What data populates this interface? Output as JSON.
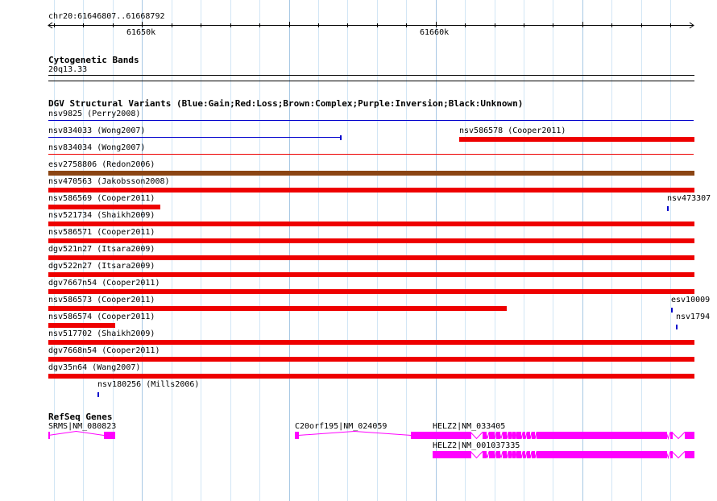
{
  "ruler": {
    "range_label": "chr20:61646807..61668792",
    "ticks": [
      {
        "label": "61650k",
        "pos": 61650000
      },
      {
        "label": "61660k",
        "pos": 61660000
      }
    ],
    "start": 61646807,
    "end": 61668792
  },
  "cytoband": {
    "title": "Cytogenetic Bands",
    "band": "20q13.33"
  },
  "dgv": {
    "title": "DGV Structural Variants (Blue:Gain;Red:Loss;Brown:Complex;Purple:Inversion;Black:Unknown)",
    "colors": {
      "gain": "#0000cc",
      "loss": "#ee0000",
      "complex": "#8b4513",
      "inversion": "#800080",
      "unknown": "#000000"
    },
    "rows": [
      {
        "features": [
          {
            "label": "nsv9825 (Perry2008)",
            "type": "gain",
            "style": "line",
            "start": 61646807,
            "end": 61668792
          }
        ]
      },
      {
        "features": [
          {
            "label": "nsv834033 (Wong2007)",
            "type": "gain",
            "style": "line",
            "start": 61646807,
            "end": 61656750
          },
          {
            "label": "nsv586578 (Cooper2011)",
            "type": "loss",
            "style": "bar",
            "start": 61660800,
            "end": 61668792
          }
        ]
      },
      {
        "features": [
          {
            "label": "nsv834034 (Wong2007)",
            "type": "loss",
            "style": "line",
            "start": 61646807,
            "end": 61668792
          }
        ]
      },
      {
        "features": [
          {
            "label": "esv2758806 (Redon2006)",
            "type": "complex",
            "style": "bar",
            "start": 61646807,
            "end": 61668792
          }
        ]
      },
      {
        "features": [
          {
            "label": "nsv470563 (Jakobsson2008)",
            "type": "loss",
            "style": "bar",
            "start": 61646807,
            "end": 61668792
          }
        ]
      },
      {
        "features": [
          {
            "label": "nsv586569 (Cooper2011)",
            "type": "loss",
            "style": "bar",
            "start": 61646807,
            "end": 61650600
          },
          {
            "label": "nsv473307",
            "type": "gain",
            "style": "tick",
            "start": 61667880,
            "end": 61667950
          }
        ]
      },
      {
        "features": [
          {
            "label": "nsv521734 (Shaikh2009)",
            "type": "loss",
            "style": "bar",
            "start": 61646807,
            "end": 61668792
          }
        ]
      },
      {
        "features": [
          {
            "label": "nsv586571 (Cooper2011)",
            "type": "loss",
            "style": "bar",
            "start": 61646807,
            "end": 61668792
          }
        ]
      },
      {
        "features": [
          {
            "label": "dgv521n27 (Itsara2009)",
            "type": "loss",
            "style": "bar",
            "start": 61646807,
            "end": 61668792
          }
        ]
      },
      {
        "features": [
          {
            "label": "dgv522n27 (Itsara2009)",
            "type": "loss",
            "style": "bar",
            "start": 61646807,
            "end": 61668792
          }
        ]
      },
      {
        "features": [
          {
            "label": "dgv7667n54 (Cooper2011)",
            "type": "loss",
            "style": "bar",
            "start": 61646807,
            "end": 61668792
          }
        ]
      },
      {
        "features": [
          {
            "label": "nsv586573 (Cooper2011)",
            "type": "loss",
            "style": "bar",
            "start": 61646807,
            "end": 61662400
          },
          {
            "label": "esv10009",
            "type": "gain",
            "style": "tick",
            "start": 61668010,
            "end": 61668080
          }
        ]
      },
      {
        "features": [
          {
            "label": "nsv586574 (Cooper2011)",
            "type": "loss",
            "style": "bar",
            "start": 61646807,
            "end": 61649050
          },
          {
            "label": "nsv1794",
            "type": "gain",
            "style": "tick",
            "start": 61668180,
            "end": 61668250
          }
        ]
      },
      {
        "features": [
          {
            "label": "nsv517702 (Shaikh2009)",
            "type": "loss",
            "style": "bar",
            "start": 61646807,
            "end": 61668792
          }
        ]
      },
      {
        "features": [
          {
            "label": "dgv7668n54 (Cooper2011)",
            "type": "loss",
            "style": "bar",
            "start": 61646807,
            "end": 61668792
          }
        ]
      },
      {
        "features": [
          {
            "label": "dgv35n64 (Wang2007)",
            "type": "loss",
            "style": "bar",
            "start": 61646807,
            "end": 61668792
          }
        ]
      },
      {
        "features": [
          {
            "label": "nsv180256 (Mills2006)",
            "type": "gain",
            "style": "tick",
            "start": 61648480,
            "end": 61648550
          }
        ]
      }
    ]
  },
  "refseq": {
    "title": "RefSeq Genes",
    "color": "#ff00ff",
    "genes": [
      {
        "label": "SRMS|NM_080823",
        "start": 61646807,
        "end": 61649050,
        "exons": [
          [
            61646807,
            61646820
          ],
          [
            61648700,
            61649050
          ]
        ],
        "chevron": "up"
      },
      {
        "label": "C20orf195|NM_024059",
        "start": 61655200,
        "end": 61660260,
        "exons": [
          [
            61655200,
            61655320
          ],
          [
            61659170,
            61660260
          ]
        ],
        "chevron": "up"
      },
      {
        "label": "HELZ2|NM_033405",
        "start": 61659890,
        "end": 61668792,
        "exons": [
          [
            61659890,
            61661200
          ],
          [
            61661600,
            61661700
          ],
          [
            61661820,
            61661980
          ],
          [
            61662060,
            61662180
          ],
          [
            61662280,
            61662390
          ],
          [
            61662480,
            61662560
          ],
          [
            61662620,
            61662700
          ],
          [
            61662760,
            61662880
          ],
          [
            61662960,
            61663030
          ],
          [
            61663100,
            61663200
          ],
          [
            61663280,
            61663360
          ],
          [
            61663450,
            61667850
          ],
          [
            61667990,
            61668060
          ],
          [
            61668500,
            61668792
          ]
        ],
        "chevron": "down"
      },
      {
        "label": "HELZ2|NM_001037335",
        "start": 61659890,
        "end": 61668792,
        "exons": [
          [
            61659890,
            61661200
          ],
          [
            61661600,
            61661700
          ],
          [
            61661820,
            61661980
          ],
          [
            61662060,
            61662180
          ],
          [
            61662280,
            61662390
          ],
          [
            61662480,
            61662560
          ],
          [
            61662620,
            61662700
          ],
          [
            61662760,
            61662880
          ],
          [
            61662960,
            61663030
          ],
          [
            61663100,
            61663200
          ],
          [
            61663280,
            61663360
          ],
          [
            61663450,
            61667850
          ],
          [
            61667990,
            61668060
          ],
          [
            61668500,
            61668792
          ]
        ],
        "chevron": "down"
      }
    ]
  }
}
